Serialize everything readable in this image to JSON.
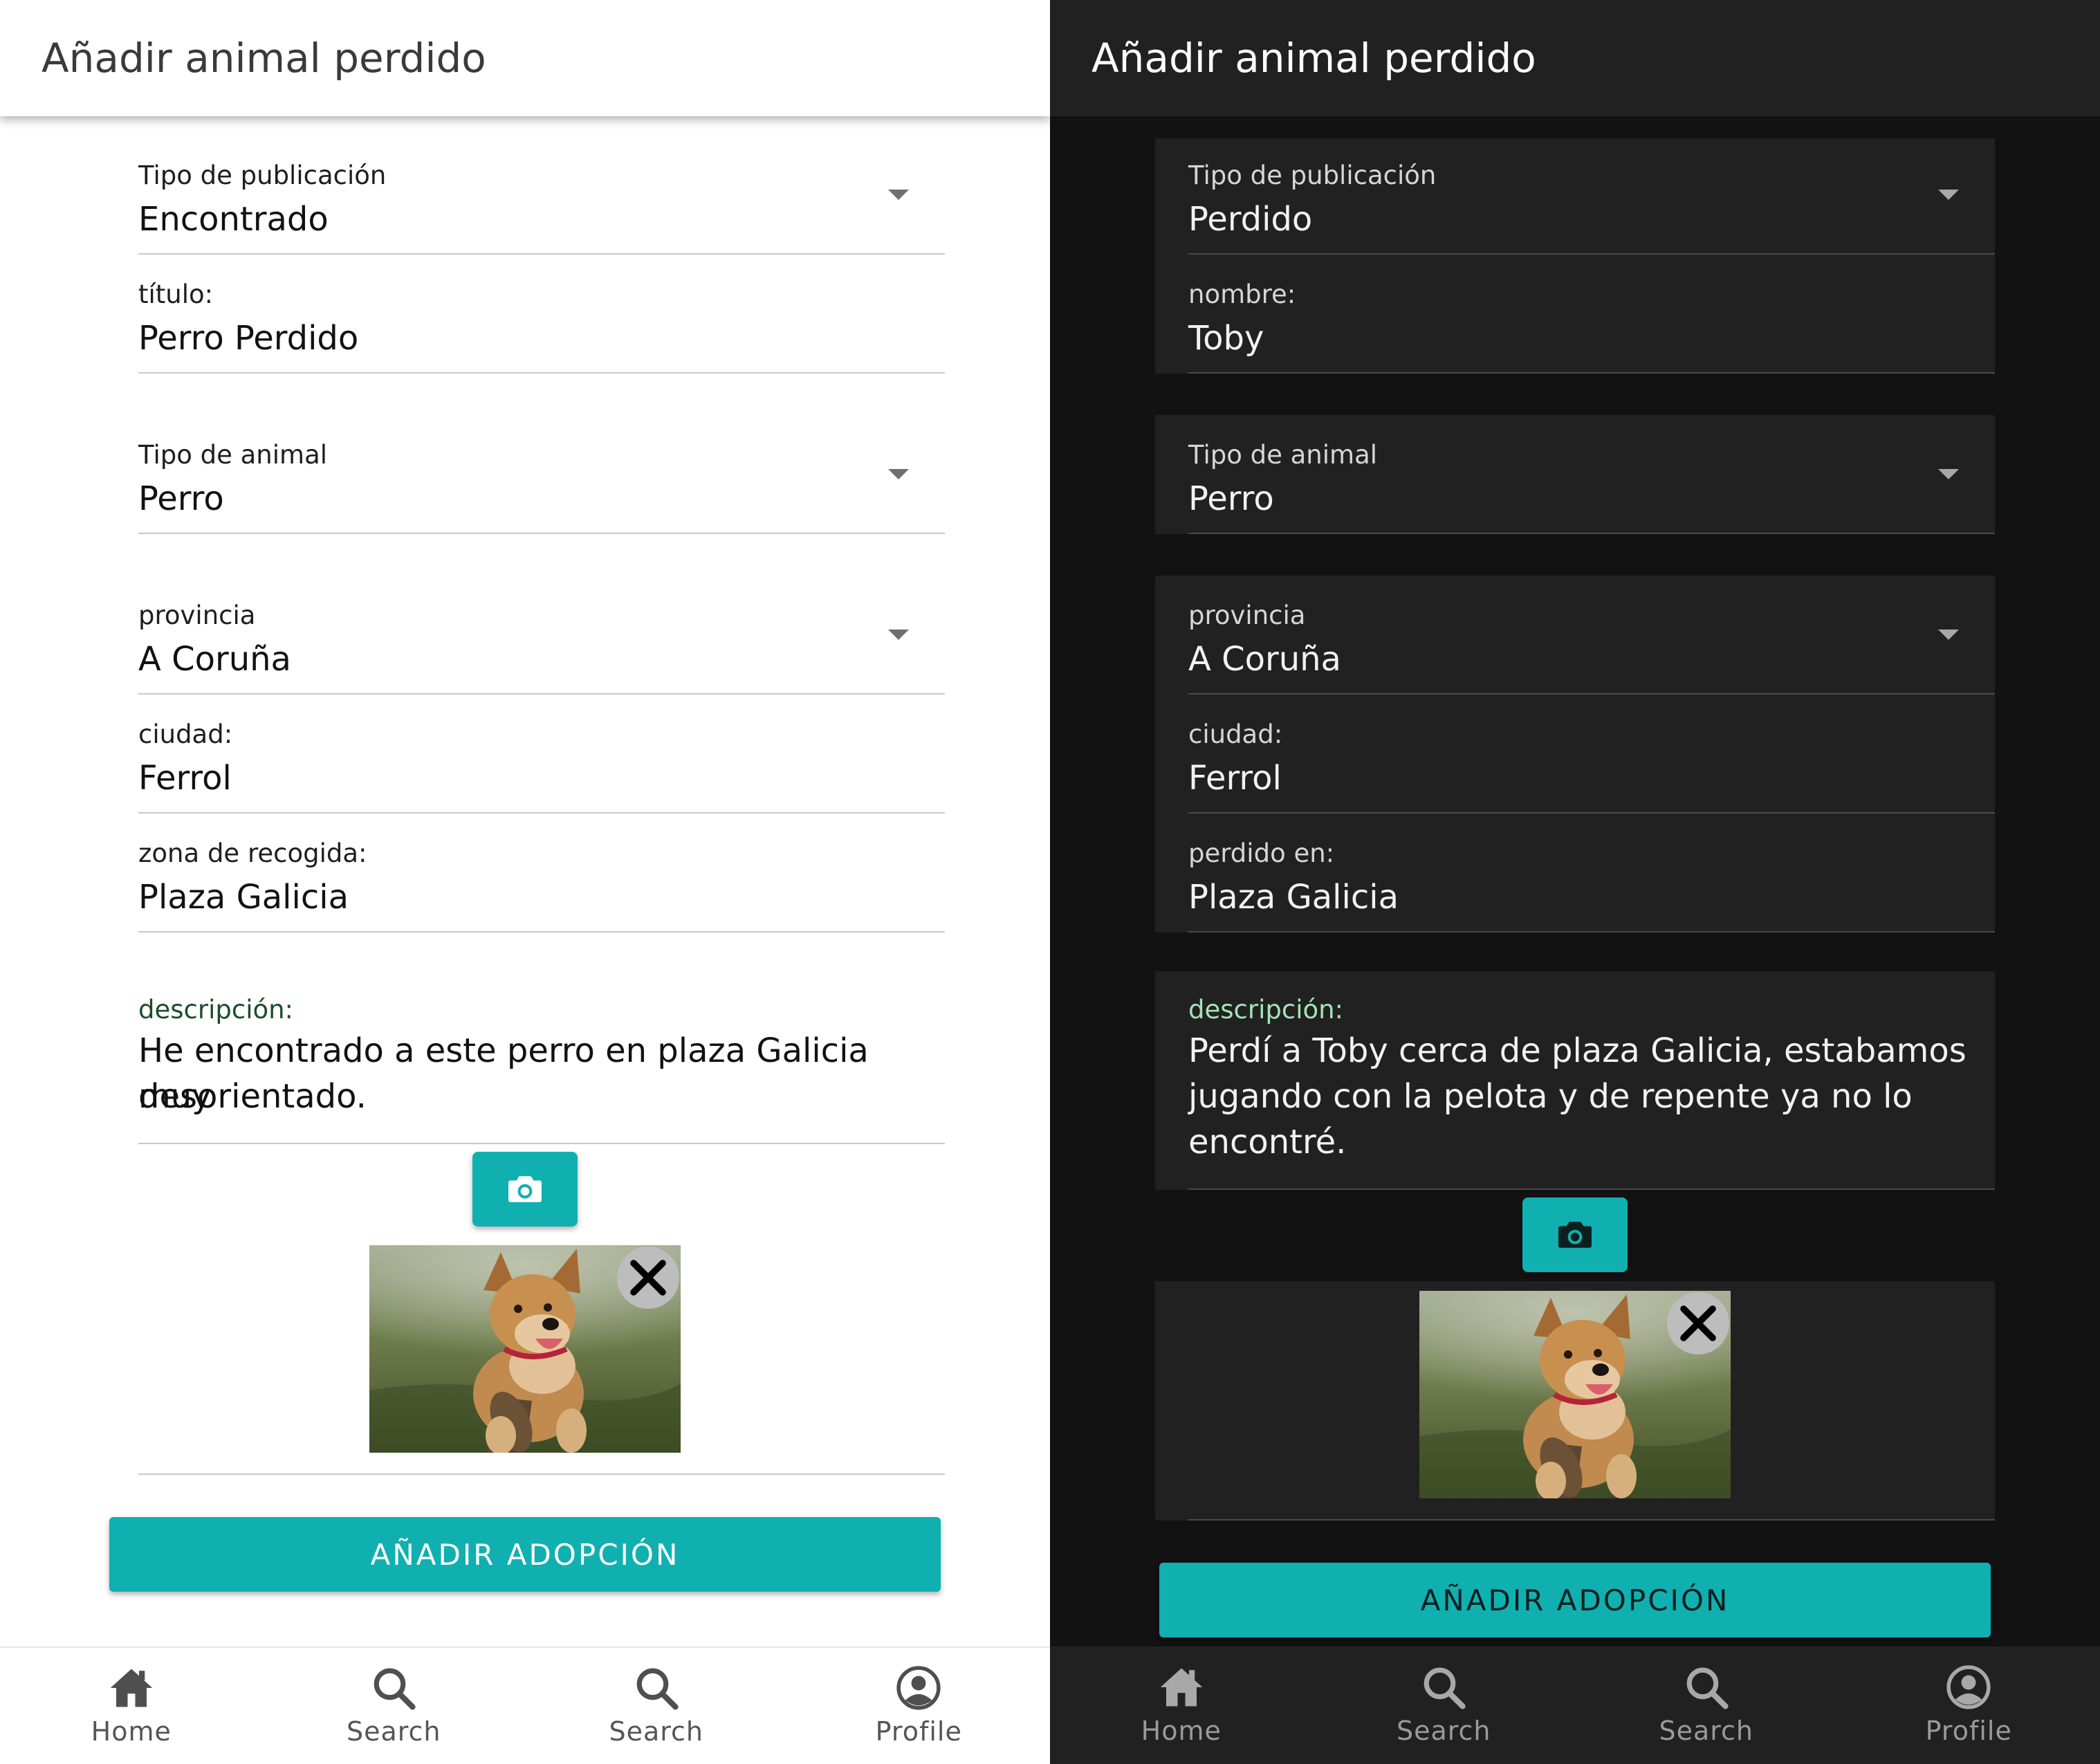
{
  "colors": {
    "accent": "#10b0b0",
    "light_bg": "#ffffff",
    "dark_bg": "#121212",
    "dark_surface": "#212121"
  },
  "light": {
    "title": "Añadir animal perdido",
    "publication_type": {
      "label": "Tipo de publicación",
      "value": "Encontrado"
    },
    "title_field": {
      "label": "título:",
      "value": "Perro Perdido"
    },
    "animal_type": {
      "label": "Tipo de animal",
      "value": "Perro"
    },
    "province": {
      "label": "provincia",
      "value": "A Coruña"
    },
    "city": {
      "label": "ciudad:",
      "value": "Ferrol"
    },
    "place": {
      "label": "zona de recogida:",
      "value": "Plaza Galicia"
    },
    "description": {
      "label": "descripción:",
      "line1": "He encontrado a este perro en plaza Galicia muy",
      "line2": "desorientado."
    },
    "camera_icon": "camera-icon",
    "close_icon": "close-icon",
    "submit_label": "AÑADIR ADOPCIÓN",
    "nav": [
      {
        "label": "Home",
        "icon": "home-icon"
      },
      {
        "label": "Search",
        "icon": "search-icon"
      },
      {
        "label": "Search",
        "icon": "search-icon"
      },
      {
        "label": "Profile",
        "icon": "profile-icon"
      }
    ]
  },
  "dark": {
    "title": "Añadir animal perdido",
    "publication_type": {
      "label": "Tipo de publicación",
      "value": "Perdido"
    },
    "name_field": {
      "label": "nombre:",
      "value": "Toby"
    },
    "animal_type": {
      "label": "Tipo de animal",
      "value": "Perro"
    },
    "province": {
      "label": "provincia",
      "value": "A Coruña"
    },
    "city": {
      "label": "ciudad:",
      "value": "Ferrol"
    },
    "place": {
      "label": "perdido en:",
      "value": "Plaza Galicia"
    },
    "description": {
      "label": "descripción:",
      "line1": "Perdí a Toby cerca de plaza Galicia, estabamos",
      "line2": "jugando con la pelota y de repente ya no lo",
      "line3": "encontré."
    },
    "camera_icon": "camera-icon",
    "close_icon": "close-icon",
    "submit_label": "AÑADIR ADOPCIÓN",
    "nav": [
      {
        "label": "Home",
        "icon": "home-icon"
      },
      {
        "label": "Search",
        "icon": "search-icon"
      },
      {
        "label": "Search",
        "icon": "search-icon"
      },
      {
        "label": "Profile",
        "icon": "profile-icon"
      }
    ]
  }
}
